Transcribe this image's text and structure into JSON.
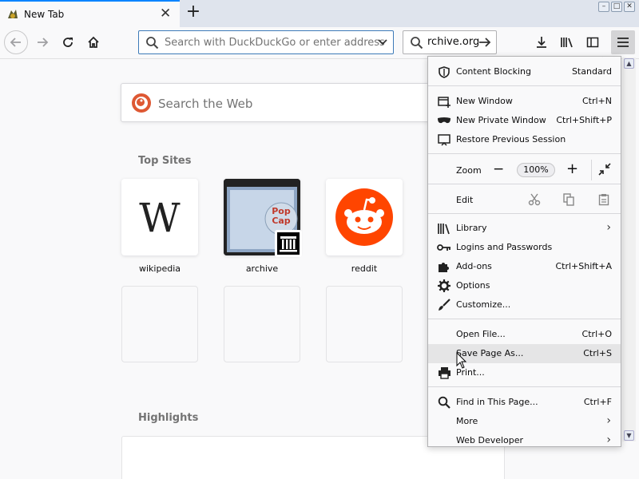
{
  "tab": {
    "title": "New Tab"
  },
  "urlbar": {
    "placeholder": "Search with DuckDuckGo or enter address"
  },
  "searchbar": {
    "value": "rchive.org"
  },
  "newtab": {
    "search_placeholder": "Search the Web",
    "top_sites_title": "Top Sites",
    "highlights_title": "Highlights",
    "tiles": [
      "wikipedia",
      "archive",
      "reddit"
    ]
  },
  "menu": {
    "content_blocking": {
      "label": "Content Blocking",
      "value": "Standard"
    },
    "new_window": {
      "label": "New Window",
      "shortcut": "Ctrl+N"
    },
    "new_private_window": {
      "label": "New Private Window",
      "shortcut": "Ctrl+Shift+P"
    },
    "restore_session": {
      "label": "Restore Previous Session"
    },
    "zoom": {
      "label": "Zoom",
      "value": "100%"
    },
    "edit": {
      "label": "Edit"
    },
    "library": {
      "label": "Library"
    },
    "logins": {
      "label": "Logins and Passwords"
    },
    "addons": {
      "label": "Add-ons",
      "shortcut": "Ctrl+Shift+A"
    },
    "options": {
      "label": "Options"
    },
    "customize": {
      "label": "Customize..."
    },
    "open_file": {
      "label": "Open File...",
      "shortcut": "Ctrl+O"
    },
    "save_page": {
      "label": "Save Page As...",
      "shortcut": "Ctrl+S"
    },
    "print": {
      "label": "Print..."
    },
    "find": {
      "label": "Find in This Page...",
      "shortcut": "Ctrl+F"
    },
    "more": {
      "label": "More"
    },
    "web_developer": {
      "label": "Web Developer"
    }
  },
  "colors": {
    "accent": "#0a84ff",
    "reddit": "#ff4500",
    "ddg": "#de5833"
  }
}
